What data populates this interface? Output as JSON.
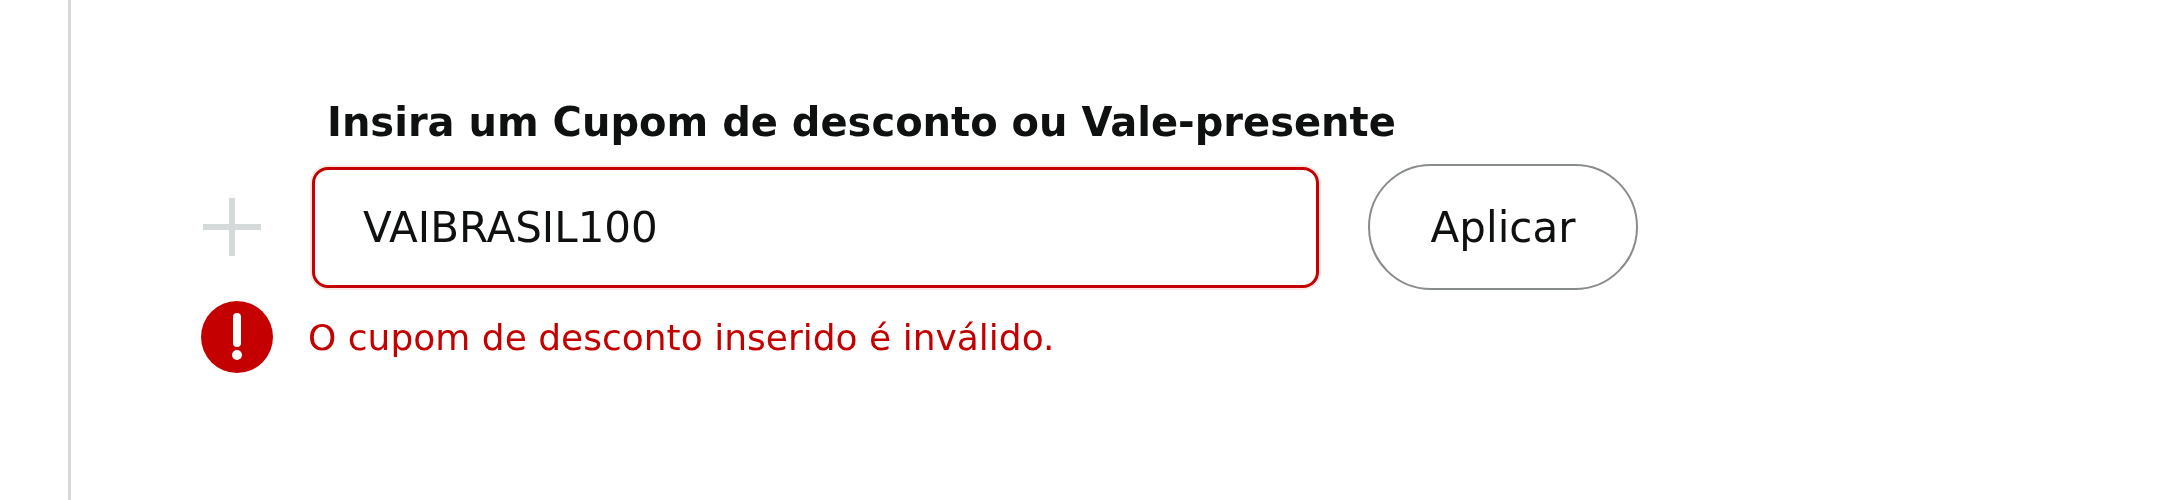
{
  "heading": "Insira um Cupom de desconto ou Vale-presente",
  "coupon_field": {
    "value": "VAIBRASIL100",
    "invalid": true
  },
  "apply_button": {
    "label": "Aplicar"
  },
  "error": {
    "message": "O cupom de desconto inserido é inválido."
  }
}
